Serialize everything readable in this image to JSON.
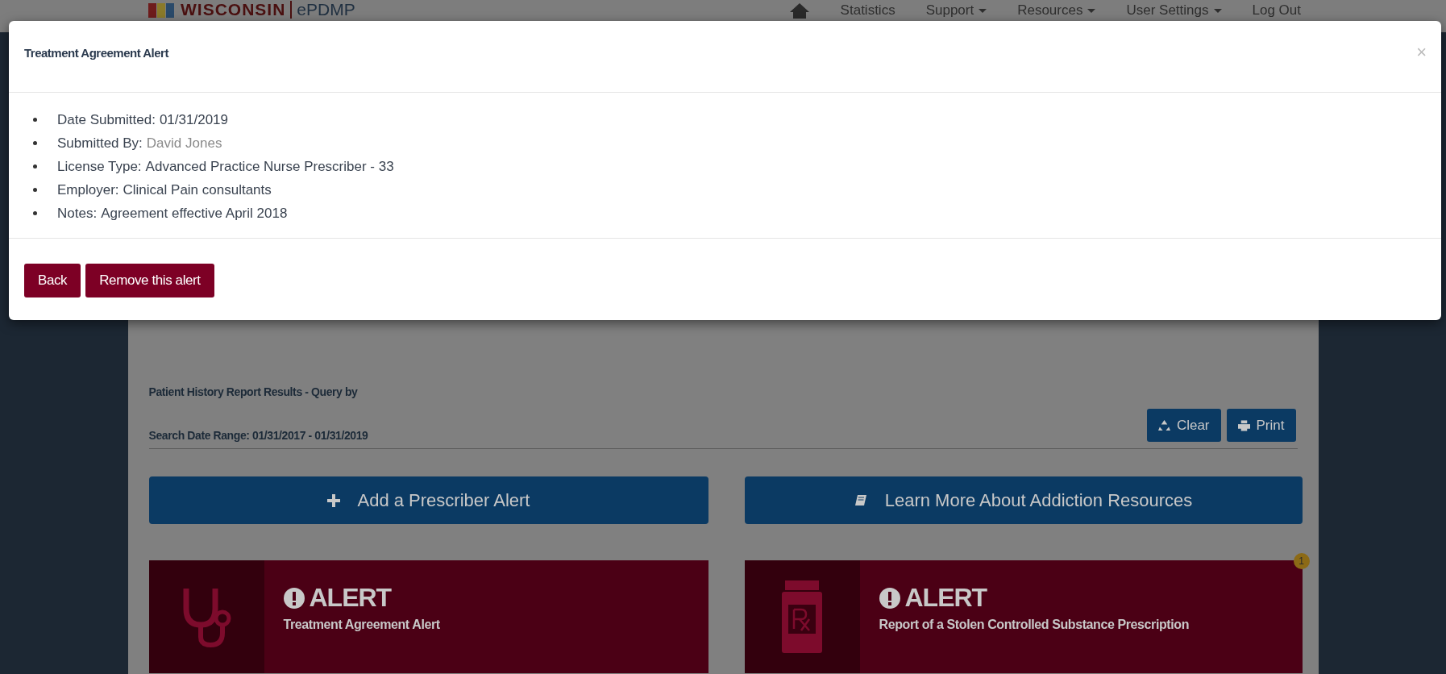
{
  "navbar": {
    "logo": {
      "state_name": "WISCONSIN",
      "product": "ePDMP"
    },
    "items": [
      {
        "label": "Statistics",
        "dropdown": false
      },
      {
        "label": "Support",
        "dropdown": true
      },
      {
        "label": "Resources",
        "dropdown": true
      },
      {
        "label": "User Settings",
        "dropdown": true
      },
      {
        "label": "Log Out",
        "dropdown": false
      }
    ]
  },
  "modal": {
    "title": "Treatment Agreement Alert",
    "close": "×",
    "details": [
      {
        "label": "Date Submitted:",
        "value": "01/31/2019",
        "kind": "text"
      },
      {
        "label": "Submitted By:",
        "value": "David Jones",
        "kind": "link"
      },
      {
        "label": "License Type:",
        "value": "Advanced Practice Nurse Prescriber - 33",
        "kind": "text"
      },
      {
        "label": "Employer:",
        "value": "Clinical Pain consultants",
        "kind": "text"
      },
      {
        "label": "Notes:",
        "value": "Agreement effective April 2018",
        "kind": "text"
      }
    ],
    "buttons": [
      "Back",
      "Remove this alert"
    ]
  },
  "report": {
    "title": "Patient History Report Results - Query by",
    "date_range": "Search Date Range: 01/31/2017 - 01/31/2019",
    "buttons": [
      {
        "label": "Clear",
        "kind": "clear"
      },
      {
        "label": "Print",
        "kind": "print"
      }
    ]
  },
  "actions": [
    {
      "label": "Add a Prescriber Alert",
      "kind": "add"
    },
    {
      "label": "Learn More About Addiction Resources",
      "kind": "learn"
    }
  ],
  "alerts": [
    {
      "heading": "ALERT",
      "text": "Treatment Agreement Alert",
      "kind": "agreement"
    },
    {
      "heading": "ALERT",
      "text": "Report of a Stolen Controlled Substance Prescription",
      "kind": "stolen",
      "badge": "1"
    }
  ]
}
